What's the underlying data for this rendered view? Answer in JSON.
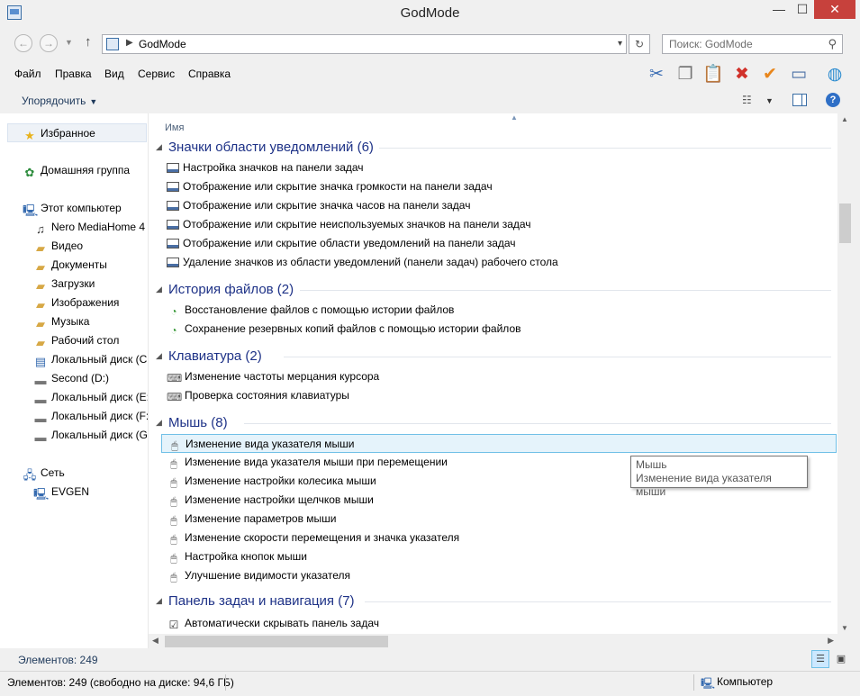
{
  "window": {
    "title": "GodMode",
    "minimize": "—",
    "maximize": "☐",
    "close": "✕"
  },
  "address": {
    "path": "GodMode",
    "search_placeholder": "Поиск: GodMode"
  },
  "menu": [
    "Файл",
    "Правка",
    "Вид",
    "Сервис",
    "Справка"
  ],
  "toolbar_icons": [
    "cut-icon",
    "copy-icon",
    "paste-icon",
    "delete-icon",
    "check-icon",
    "properties-icon",
    "globe-icon"
  ],
  "command_bar": {
    "organize": "Упорядочить"
  },
  "nav_pane": {
    "favorites": "Избранное",
    "homegroup": "Домашняя группа",
    "this_pc": "Этот компьютер",
    "pc_items": [
      "Nero MediaHome 4",
      "Видео",
      "Документы",
      "Загрузки",
      "Изображения",
      "Музыка",
      "Рабочий стол",
      "Локальный диск (C:)",
      "Second (D:)",
      "Локальный диск (E:)",
      "Локальный диск (F:)",
      "Локальный диск (G:)"
    ],
    "network": "Сеть",
    "network_items": [
      "EVGEN"
    ]
  },
  "content": {
    "column_header": "Имя",
    "groups": [
      {
        "title": "Значки области уведомлений (6)",
        "icon": "taskbar-icon",
        "items": [
          "Настройка значков на панели задач",
          "Отображение или скрытие значка громкости на панели задач",
          "Отображение или скрытие значка часов на панели задач",
          "Отображение или скрытие неиспользуемых значков на панели задач",
          "Отображение или скрытие области уведомлений на панели задач",
          "Удаление значков из области уведомлений (панели задач) рабочего стола"
        ]
      },
      {
        "title": "История файлов (2)",
        "icon": "file-history-icon",
        "items": [
          "Восстановление файлов с помощью истории файлов",
          "Сохранение резервных копий файлов с помощью истории файлов"
        ]
      },
      {
        "title": "Клавиатура (2)",
        "icon": "keyboard-icon",
        "items": [
          "Изменение частоты мерцания курсора",
          "Проверка состояния клавиатуры"
        ]
      },
      {
        "title": "Мышь (8)",
        "icon": "mouse-icon",
        "items": [
          "Изменение вида указателя мыши",
          "Изменение вида указателя мыши при перемещении",
          "Изменение настройки колесика мыши",
          "Изменение настройки щелчков мыши",
          "Изменение параметров мыши",
          "Изменение скорости перемещения и значка указателя",
          "Настройка кнопок мыши",
          "Улучшение видимости указателя"
        ]
      },
      {
        "title": "Панель задач и навигация (7)",
        "icon": "taskbar-check-icon",
        "items": [
          "Автоматически скрывать панель задач"
        ]
      }
    ]
  },
  "tooltip": {
    "line1": "Мышь",
    "line2": "Изменение вида указателя мыши"
  },
  "item_count": "Элементов: 249",
  "status": {
    "text": "Элементов: 249 (свободно на диске: 94,6 ГБ)",
    "computer": "Компьютер"
  }
}
